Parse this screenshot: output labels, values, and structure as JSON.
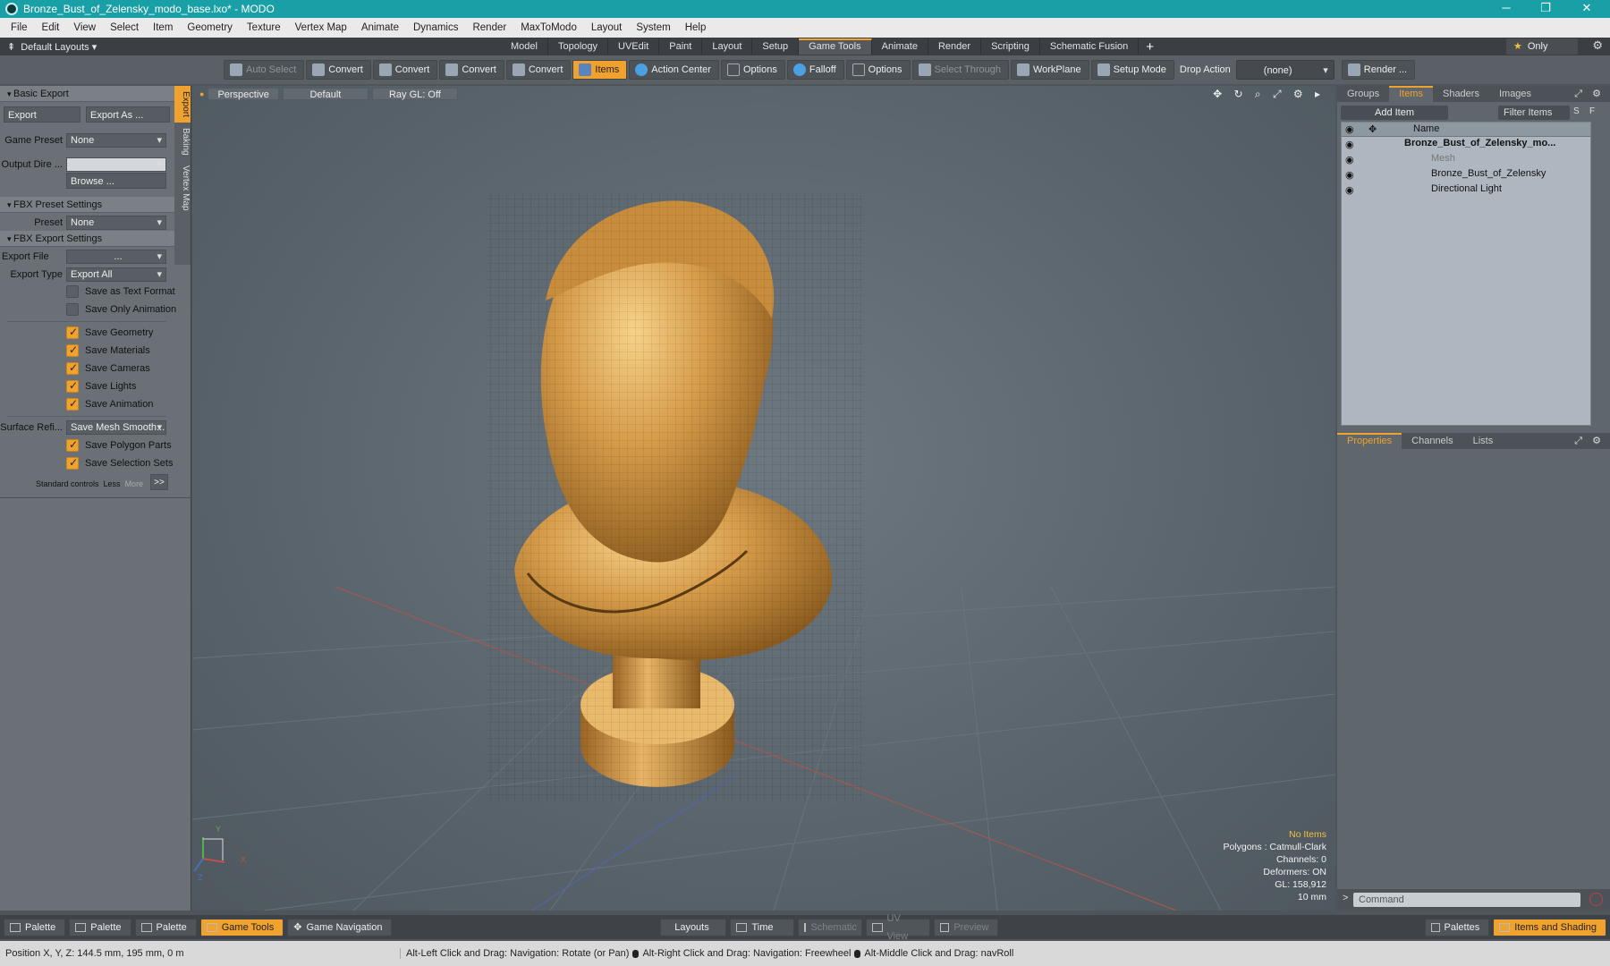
{
  "window": {
    "title": "Bronze_Bust_of_Zelensky_modo_base.lxo* - MODO",
    "minimize": "─",
    "maximize": "❐",
    "close": "✕"
  },
  "menu": [
    "File",
    "Edit",
    "View",
    "Select",
    "Item",
    "Geometry",
    "Texture",
    "Vertex Map",
    "Animate",
    "Dynamics",
    "Render",
    "MaxToModo",
    "Layout",
    "System",
    "Help"
  ],
  "layoutbar": {
    "layouts_label": "Default Layouts ▾",
    "tabs": [
      {
        "label": "Model",
        "active": false
      },
      {
        "label": "Topology",
        "active": false
      },
      {
        "label": "UVEdit",
        "active": false
      },
      {
        "label": "Paint",
        "active": false
      },
      {
        "label": "Layout",
        "active": false
      },
      {
        "label": "Setup",
        "active": false
      },
      {
        "label": "Game Tools",
        "active": true
      },
      {
        "label": "Animate",
        "active": false
      },
      {
        "label": "Render",
        "active": false
      },
      {
        "label": "Scripting",
        "active": false
      },
      {
        "label": "Schematic Fusion",
        "active": false
      }
    ],
    "plus": "+",
    "only_star": "★",
    "only_label": "Only",
    "gear": "⚙"
  },
  "toolbar": {
    "auto_select": "Auto Select",
    "convert": "Convert",
    "items": "Items",
    "action_center": "Action Center",
    "options": "Options",
    "falloff": "Falloff",
    "select_through": "Select Through",
    "workplane": "WorkPlane",
    "setup_mode": "Setup Mode",
    "drop_action": "Drop Action",
    "drop_value": "(none)",
    "render": "Render ..."
  },
  "leftpanel": {
    "sidetabs": [
      "Export",
      "Baking",
      "Vertex Map"
    ],
    "basic_export": "Basic Export",
    "export_btn": "Export",
    "export_as_btn": "Export As ...",
    "game_preset_label": "Game Preset",
    "game_preset_value": "None",
    "output_dir_label": "Output Dire ...",
    "browse": "Browse ...",
    "fbx_preset_settings": "FBX Preset Settings",
    "preset_label": "Preset",
    "preset_value": "None",
    "fbx_export_settings": "FBX Export Settings",
    "export_file_label": "Export File",
    "export_file_value": "...",
    "export_type_label": "Export Type",
    "export_type_value": "Export All",
    "save_text": "Save as Text Format",
    "save_only_anim": "Save Only Animation",
    "save_geometry": "Save Geometry",
    "save_materials": "Save Materials",
    "save_cameras": "Save Cameras",
    "save_lights": "Save Lights",
    "save_animation": "Save Animation",
    "surface_label": "Surface Refi...",
    "surface_value": "Save Mesh Smooth...",
    "save_polygon_parts": "Save Polygon Parts",
    "save_selection_sets": "Save Selection Sets",
    "standard_controls": "Standard controls",
    "less": "Less",
    "more": "More",
    "expand": ">>"
  },
  "viewport": {
    "perspective": "Perspective",
    "default": "Default",
    "raygl": "Ray GL: Off",
    "icons": "✥ ↻ ⌕ ⤢ ⚙ ▸",
    "info": {
      "no_items": "No Items",
      "polygons": "Polygons : Catmull-Clark",
      "channels": "Channels: 0",
      "deformers": "Deformers: ON",
      "gl": "GL: 158,912",
      "scale": "10 mm"
    },
    "axis_y": "Y",
    "axis_x": "X",
    "axis_z": "Z"
  },
  "rightpanel": {
    "top_tabs": [
      "Groups",
      "Items",
      "Shaders",
      "Images"
    ],
    "top_active": "Items",
    "add_item": "Add Item",
    "filter_items": "Filter Items",
    "s": "S",
    "f": "F",
    "name_header": "Name",
    "items": [
      {
        "name": "Bronze_Bust_of_Zelensky_mo...",
        "bold": true,
        "indent": 0
      },
      {
        "name": "Mesh",
        "dim": true,
        "indent": 1
      },
      {
        "name": "Bronze_Bust_of_Zelensky",
        "indent": 1
      },
      {
        "name": "Directional Light",
        "indent": 1
      }
    ],
    "bottom_tabs": [
      "Properties",
      "Channels",
      "Lists"
    ],
    "bottom_active": "Properties",
    "command_placeholder": "Command",
    "prompt": ">"
  },
  "palettebar": {
    "palette": "Palette",
    "game_tools": "Game Tools",
    "game_navigation": "Game Navigation",
    "layouts": "Layouts",
    "time": "Time",
    "schematic": "Schematic",
    "uv_view": "UV View",
    "preview": "Preview",
    "palettes": "Palettes",
    "items_and_shading": "Items and Shading"
  },
  "statusbar": {
    "position": "Position X, Y, Z:   144.5 mm, 195 mm, 0 m",
    "hint1": "Alt-Left Click and Drag: Navigation: Rotate (or Pan)",
    "hint2": "Alt-Right Click and Drag: Navigation: Freewheel",
    "hint3": "Alt-Middle Click and Drag: navRoll"
  },
  "colors": {
    "accent": "#f0a22f",
    "titlebar": "#18a0a6",
    "bronze": "#c8913e"
  }
}
